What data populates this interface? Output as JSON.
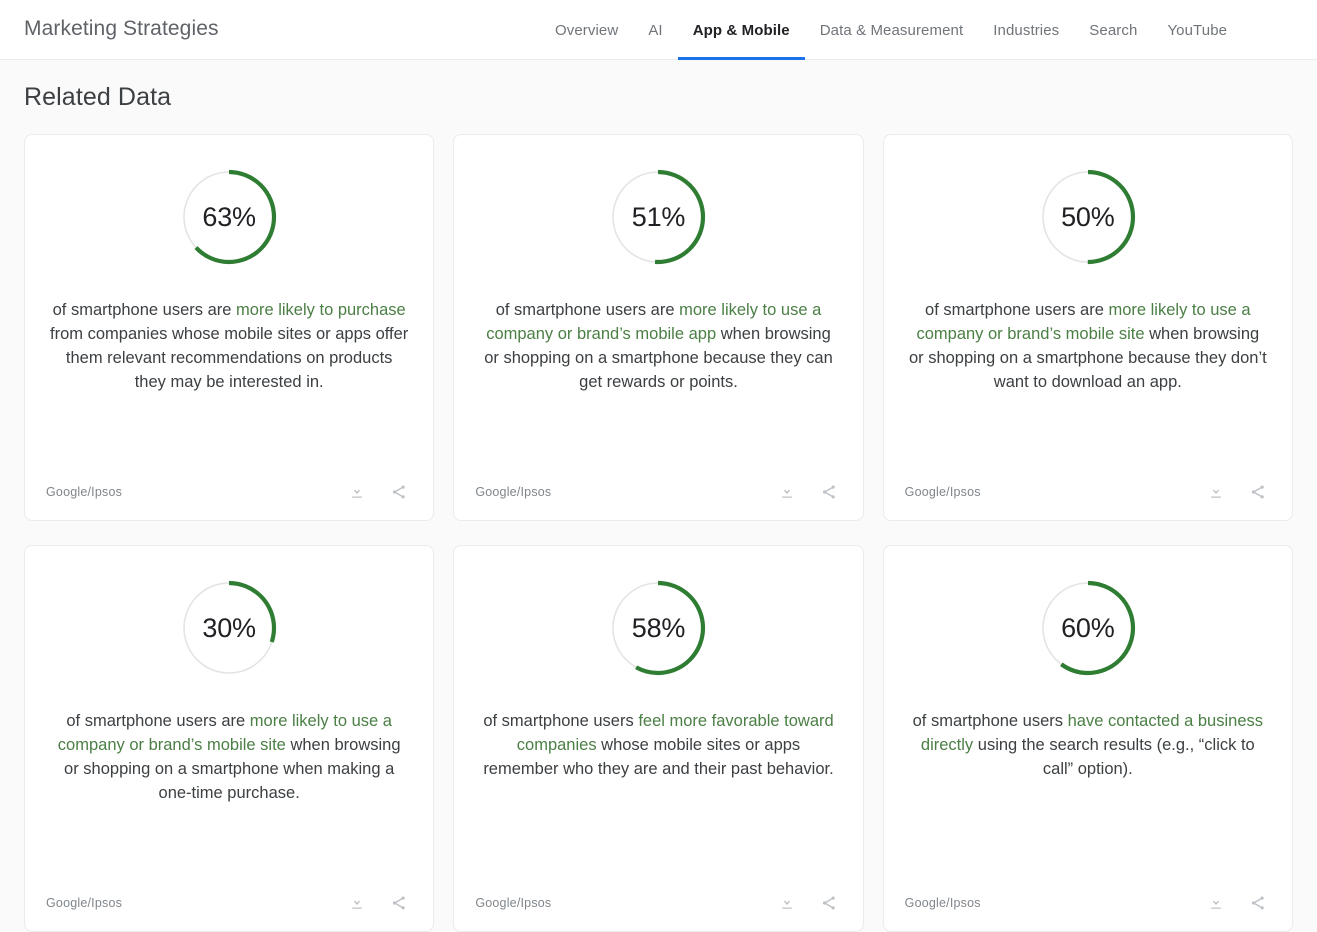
{
  "header": {
    "brand": "Marketing Strategies",
    "nav": [
      {
        "label": "Overview",
        "active": false
      },
      {
        "label": "AI",
        "active": false
      },
      {
        "label": "App & Mobile",
        "active": true
      },
      {
        "label": "Data & Measurement",
        "active": false
      },
      {
        "label": "Industries",
        "active": false
      },
      {
        "label": "Search",
        "active": false
      },
      {
        "label": "YouTube",
        "active": false
      }
    ],
    "active_tab": "App & Mobile",
    "accent_color": "#1a73e8"
  },
  "page": {
    "title": "Related Data",
    "background": "#fafafa"
  },
  "theme": {
    "donut_fill": "#2f7d33",
    "donut_track": "#e4e4e4",
    "highlight_text": "#4b7f45",
    "body_text": "#3c4043",
    "source_text": "#80868b"
  },
  "icons": {
    "download": "download-icon",
    "share": "share-icon"
  },
  "chart_data": {
    "type": "pie",
    "title": "Related Data",
    "note": "Six donut (radial gauge) charts, each showing a single percentage out of 100%, drawn clockwise from 12 o'clock.",
    "ylim": [
      0,
      100
    ],
    "categories": [
      "63%",
      "51%",
      "50%",
      "30%",
      "58%",
      "60%"
    ],
    "values": [
      63,
      51,
      50,
      30,
      58,
      60
    ],
    "legend": "none",
    "grid": false
  },
  "cards": [
    {
      "percent_label": "63%",
      "percent_value": 63,
      "statement": [
        {
          "text": "of smartphone users are ",
          "highlight": false
        },
        {
          "text": "more likely to purchase",
          "highlight": true
        },
        {
          "text": " from companies whose mobile sites or apps offer them relevant recommendations on products they may be interested in.",
          "highlight": false
        }
      ],
      "source": "Google/Ipsos",
      "download_label": "Download",
      "share_label": "Share"
    },
    {
      "percent_label": "51%",
      "percent_value": 51,
      "statement": [
        {
          "text": "of smartphone users are ",
          "highlight": false
        },
        {
          "text": "more likely to use a company or brand’s mobile app",
          "highlight": true
        },
        {
          "text": " when browsing or shopping on a smartphone because they can get rewards or points.",
          "highlight": false
        }
      ],
      "source": "Google/Ipsos",
      "download_label": "Download",
      "share_label": "Share"
    },
    {
      "percent_label": "50%",
      "percent_value": 50,
      "statement": [
        {
          "text": "of smartphone users are ",
          "highlight": false
        },
        {
          "text": "more likely to use a company or brand’s mobile site",
          "highlight": true
        },
        {
          "text": " when browsing or shopping on a smartphone because they don’t want to download an app.",
          "highlight": false
        }
      ],
      "source": "Google/Ipsos",
      "download_label": "Download",
      "share_label": "Share"
    },
    {
      "percent_label": "30%",
      "percent_value": 30,
      "statement": [
        {
          "text": "of smartphone users are ",
          "highlight": false
        },
        {
          "text": "more likely to use a company or brand’s mobile site",
          "highlight": true
        },
        {
          "text": " when browsing or shopping on a smartphone when making a one-time purchase.",
          "highlight": false
        }
      ],
      "source": "Google/Ipsos",
      "download_label": "Download",
      "share_label": "Share"
    },
    {
      "percent_label": "58%",
      "percent_value": 58,
      "statement": [
        {
          "text": "of smartphone users ",
          "highlight": false
        },
        {
          "text": "feel more favorable toward companies",
          "highlight": true
        },
        {
          "text": " whose mobile sites or apps remember who they are and their past behavior.",
          "highlight": false
        }
      ],
      "source": "Google/Ipsos",
      "download_label": "Download",
      "share_label": "Share"
    },
    {
      "percent_label": "60%",
      "percent_value": 60,
      "statement": [
        {
          "text": "of smartphone users ",
          "highlight": false
        },
        {
          "text": "have contacted a business directly",
          "highlight": true
        },
        {
          "text": " using the search results (e.g., “click to call” option).",
          "highlight": false
        }
      ],
      "source": "Google/Ipsos",
      "download_label": "Download",
      "share_label": "Share"
    }
  ]
}
